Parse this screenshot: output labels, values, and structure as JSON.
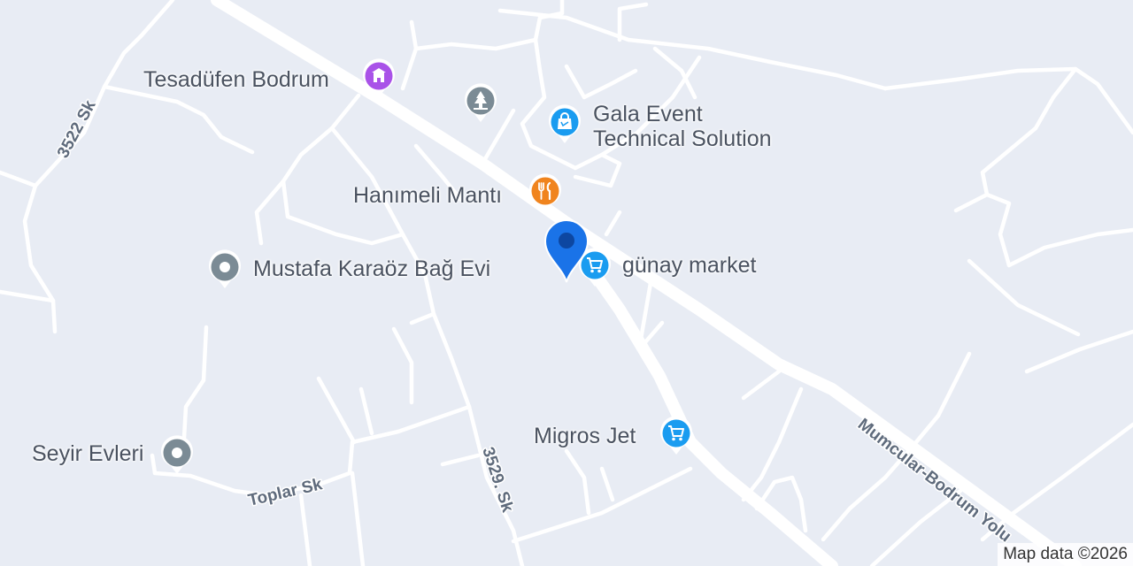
{
  "map": {
    "streets": {
      "mumcular": "Mumcular-Bodrum Yolu",
      "s3522": "3522 Sk",
      "s3529": "3529. Sk",
      "toplar": "Toplar Sk"
    },
    "pois": {
      "tesadufen": {
        "label": "Tesadüfen Bodrum",
        "icon": "shrine-icon",
        "color": "#a952e8"
      },
      "park": {
        "label": "",
        "icon": "tree-icon",
        "color": "#7b8b95"
      },
      "gala": {
        "label_line1": "Gala Event",
        "label_line2": "Technical Solution",
        "icon": "shopping-bag-icon",
        "color": "#1a9cf0"
      },
      "hanimeli": {
        "label": "Hanımeli Mantı",
        "icon": "fork-knife-icon",
        "color": "#f0841e"
      },
      "gunay": {
        "label": "günay market",
        "icon": "shopping-cart-icon",
        "color": "#1a9cf0"
      },
      "mustafa": {
        "label": "Mustafa Karaöz Bağ Evi",
        "icon": "place-dot-icon",
        "color": "#7b8b95"
      },
      "migros": {
        "label": "Migros Jet",
        "icon": "shopping-cart-icon",
        "color": "#1a9cf0"
      },
      "seyir": {
        "label": "Seyir Evleri",
        "icon": "place-dot-icon",
        "color": "#7b8b95"
      }
    },
    "location_pin": {
      "icon": "map-pin-icon",
      "color": "#1a73e8"
    },
    "attribution": "Map data ©2026"
  }
}
